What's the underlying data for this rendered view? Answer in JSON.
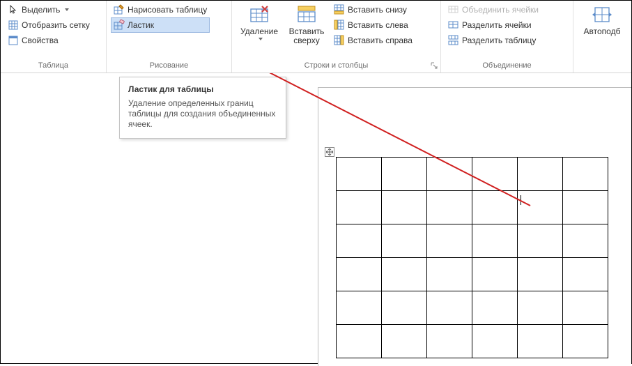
{
  "ribbon": {
    "groups": {
      "table": {
        "label": "Таблица",
        "select": "Выделить",
        "show_grid": "Отобразить сетку",
        "properties": "Свойства"
      },
      "drawing": {
        "label": "Рисование",
        "draw_table": "Нарисовать таблицу",
        "eraser": "Ластик"
      },
      "rowscols": {
        "label": "Строки и столбцы",
        "delete": "Удаление",
        "insert_above": "Вставить сверху",
        "insert_below": "Вставить снизу",
        "insert_left": "Вставить слева",
        "insert_right": "Вставить справа"
      },
      "merge": {
        "label": "Объединение",
        "merge_cells": "Объединить ячейки",
        "split_cells": "Разделить ячейки",
        "split_table": "Разделить таблицу"
      },
      "autofit": {
        "autofit": "Автоподб"
      }
    }
  },
  "tooltip": {
    "title": "Ластик для таблицы",
    "body": "Удаление определенных границ таблицы для создания объединенных ячеек."
  },
  "document": {
    "table": {
      "rows": 6,
      "cols": 6,
      "cursor_cell": {
        "row": 1,
        "col": 4
      }
    }
  }
}
